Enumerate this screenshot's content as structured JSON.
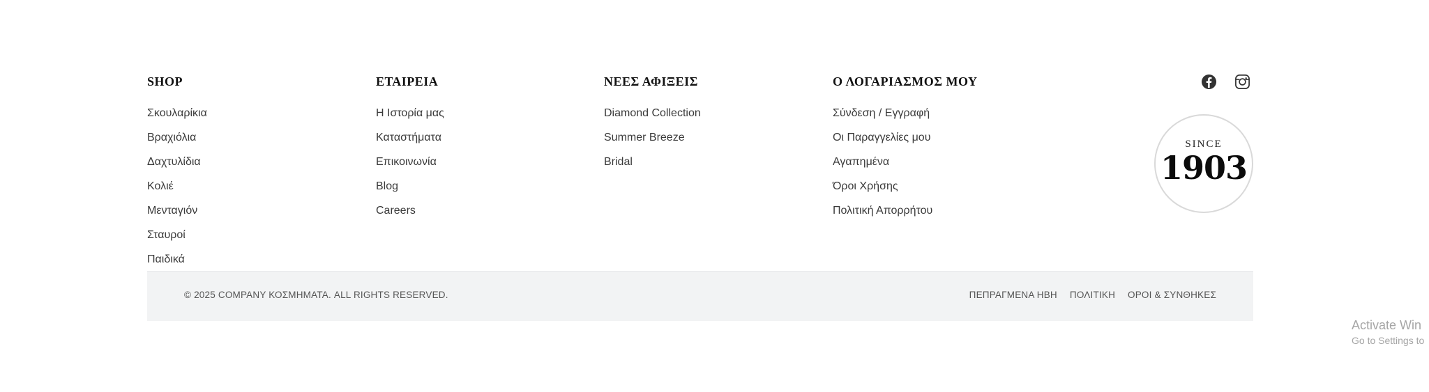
{
  "footer": {
    "columns": [
      {
        "title": "SHOP",
        "links": [
          "Σκουλαρίκια",
          "Βραχιόλια",
          "Δαχτυλίδια",
          "Κολιέ",
          "Μενταγιόν",
          "Σταυροί",
          "Παιδικά"
        ]
      },
      {
        "title": "ΕΤΑΙΡΕΙΑ",
        "links": [
          "Η Ιστορία μας",
          "Καταστήματα",
          "Επικοινωνία",
          "Blog",
          "Careers"
        ]
      },
      {
        "title": "ΝΕΕΣ ΑΦΙΞΕΙΣ",
        "links": [
          "Diamond Collection",
          "Summer Breeze",
          "Bridal"
        ]
      },
      {
        "title": "Ο ΛΟΓΑΡΙΑΣΜΟΣ ΜΟΥ",
        "links": [
          "Σύνδεση / Εγγραφή",
          "Οι Παραγγελίες μου",
          "Αγαπημένα",
          "Όροι Χρήσης",
          "Πολιτική Απορρήτου"
        ]
      }
    ],
    "social": {
      "facebook_icon": "facebook-icon",
      "instagram_icon": "instagram-icon"
    },
    "badge": {
      "since": "SINCE",
      "year": "1903"
    },
    "bottom_bar": {
      "copyright": "© 2025 COMPANY ΚΟΣΜΗΜΑΤΑ. ALL RIGHTS RESERVED.",
      "links": [
        "ΠΕΠΡΑΓΜΕΝΑ ΗΒΗ",
        "ΠΟΛΙΤΙΚΗ",
        "ΟΡΟΙ & ΣΥΝΘΗΚΕΣ"
      ]
    }
  },
  "os_watermark": {
    "title": "Activate Win",
    "subtitle": "Go to Settings to"
  },
  "colors": {
    "heading": "#111111",
    "link": "#3a3a3a",
    "bottom_bar_bg": "#f2f3f4",
    "bottom_bar_text": "#555555",
    "badge_border": "#d9d9d9",
    "icon": "#333333",
    "watermark": "#a5a5a5"
  }
}
